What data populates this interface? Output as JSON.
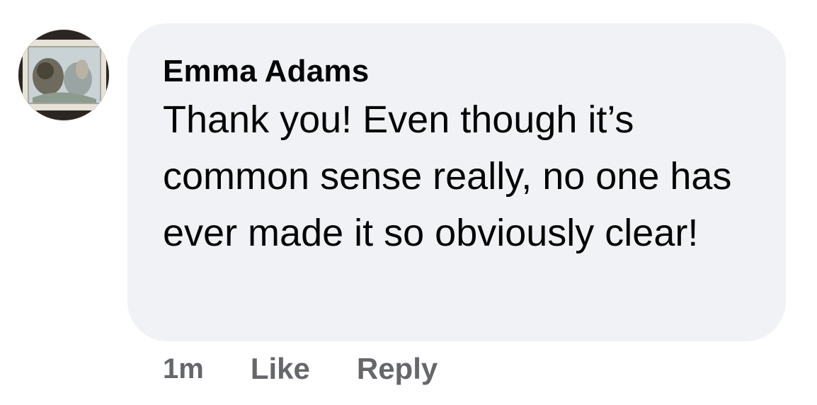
{
  "comment": {
    "author": "Emma Adams",
    "text": "Thank you! Even though it’s common sense really, no one has ever made it so obviously clear!",
    "timestamp": "1m",
    "actions": {
      "like_label": "Like",
      "reply_label": "Reply"
    },
    "colors": {
      "bubble_background": "#f0f2f5",
      "author_text": "#050505",
      "meta_text": "#65676b"
    }
  }
}
